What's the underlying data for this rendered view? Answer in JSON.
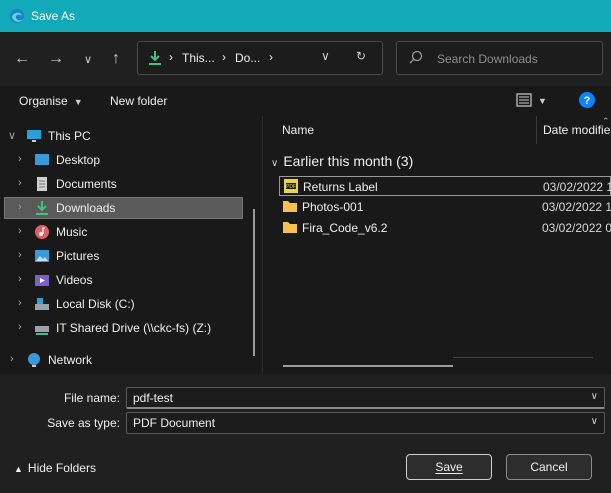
{
  "window": {
    "title": "Save As"
  },
  "address": {
    "crumbs": [
      "This...",
      "Do..."
    ]
  },
  "search": {
    "placeholder": "Search Downloads"
  },
  "toolbar": {
    "organise": "Organise",
    "new_folder": "New folder",
    "help": "?"
  },
  "sidebar": {
    "items": [
      {
        "label": "This PC",
        "icon": "pc-icon",
        "color": "#2a9fd8"
      },
      {
        "label": "Desktop",
        "icon": "desktop-icon",
        "color": "#3a9ad9"
      },
      {
        "label": "Documents",
        "icon": "documents-icon",
        "color": "#d0d0d0"
      },
      {
        "label": "Downloads",
        "icon": "download-icon",
        "color": "#3fc18b",
        "selected": true
      },
      {
        "label": "Music",
        "icon": "music-icon",
        "color": "#e06060"
      },
      {
        "label": "Pictures",
        "icon": "pictures-icon",
        "color": "#3a9ad9"
      },
      {
        "label": "Videos",
        "icon": "videos-icon",
        "color": "#7a5fd0"
      },
      {
        "label": "Local Disk (C:)",
        "icon": "local-disk-icon",
        "color": "#9aa3ad"
      },
      {
        "label": "IT Shared Drive (\\\\ckc-fs) (Z:)",
        "icon": "network-drive-icon",
        "color": "#9aa3ad"
      },
      {
        "label": "Network",
        "icon": "network-icon",
        "color": "#3a9ad9"
      }
    ]
  },
  "content": {
    "columns": [
      "Name",
      "Date modifie"
    ],
    "group_label": "Earlier this month (3)",
    "files": [
      {
        "name": "Returns Label",
        "date": "03/02/2022 1",
        "icon": "pdf-icon"
      },
      {
        "name": "Photos-001",
        "date": "03/02/2022 1",
        "icon": "folder-icon"
      },
      {
        "name": "Fira_Code_v6.2",
        "date": "03/02/2022 0",
        "icon": "folder-icon"
      }
    ]
  },
  "form": {
    "file_name_label": "File name:",
    "file_name_value": "pdf-test",
    "save_type_label": "Save as type:",
    "save_type_value": "PDF Document"
  },
  "footer": {
    "hide_folders": "Hide Folders",
    "save": "Save",
    "cancel": "Cancel"
  },
  "colors": {
    "titlebar": "#12aab8",
    "accent": "#3a9ad9",
    "help": "#0a84ff"
  }
}
